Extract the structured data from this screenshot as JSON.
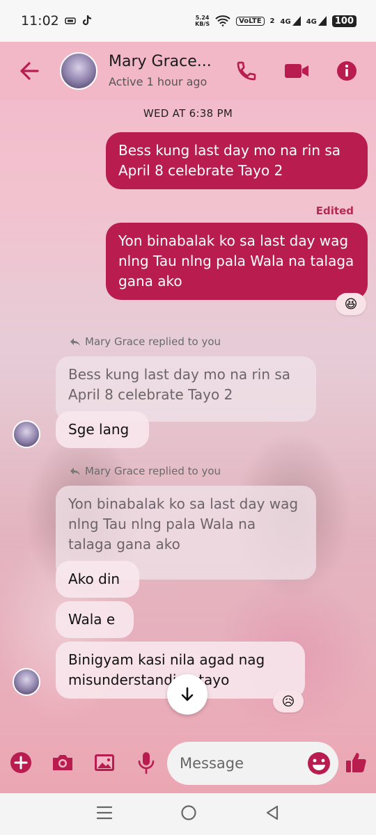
{
  "status_bar": {
    "time": "11:02",
    "network_speed_value": "5.24",
    "network_speed_unit": "KB/S",
    "volte": "VoLTE",
    "sim_label": "2",
    "net1": "4G",
    "net2": "4G",
    "battery": "100"
  },
  "header": {
    "contact_name": "Mary Grace...",
    "status": "Active 1 hour ago"
  },
  "colors": {
    "accent": "#b91d50",
    "header_bg": "#f2b8c8",
    "outgoing_bubble": "#b91d50"
  },
  "date_separator": "WED AT 6:38 PM",
  "messages": {
    "out1": "Bess kung last day mo na rin sa April 8 celebrate Tayo 2",
    "edited_label": "Edited",
    "out2": "Yon binabalak ko sa last day wag nlng Tau nlng pala Wala na talaga gana ako",
    "out2_reaction": "😆",
    "reply_note_1": "Mary Grace replied to you",
    "quote_1": "Bess kung last day mo na rin sa April 8 celebrate Tayo 2",
    "in1": "Sge lang",
    "reply_note_2": "Mary Grace replied to you",
    "quote_2": "Yon binabalak ko sa last day wag nlng Tau nlng pala Wala na talaga gana ako",
    "in2": "Ako din",
    "in3": "Wala e",
    "in4": "Binigyam kasi nila agad nag misunderstanding tayo",
    "in4_reaction": "😥"
  },
  "composer": {
    "placeholder": "Message"
  },
  "icons": [
    "back-arrow-icon",
    "phone-icon",
    "video-icon",
    "info-icon",
    "plus-icon",
    "camera-icon",
    "image-icon",
    "mic-icon",
    "emoji-icon",
    "like-icon",
    "scroll-down-icon",
    "reply-icon"
  ]
}
